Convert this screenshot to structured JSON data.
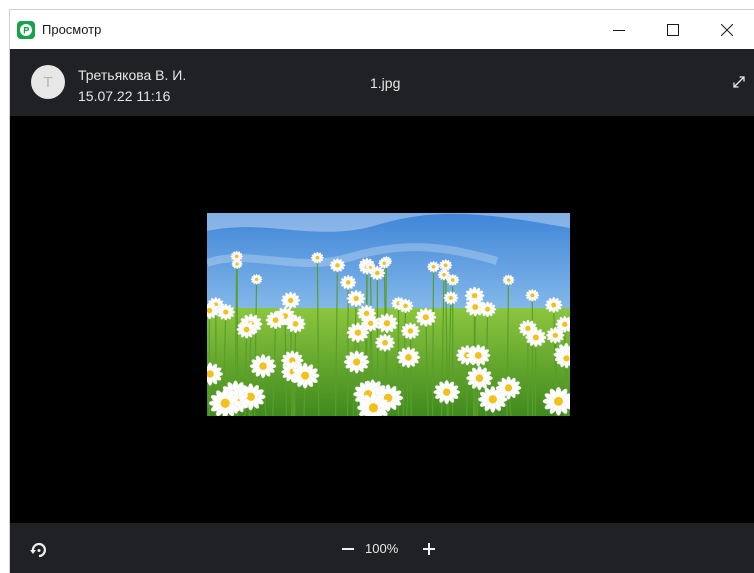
{
  "window": {
    "title": "Просмотр",
    "controls": [
      "minimize",
      "maximize",
      "close"
    ]
  },
  "header": {
    "avatar_initial": "Т",
    "author": "Третьякова В. И.",
    "date": "15.07.22 11:16",
    "filename": "1.jpg"
  },
  "footer": {
    "zoom_level": "100%"
  },
  "icons": {
    "app": "app-logo-icon",
    "expand": "expand-icon",
    "rotate": "rotate-icon",
    "zoom_out": "minus-icon",
    "zoom_in": "plus-icon"
  },
  "colors": {
    "toolbar_bg": "#202124",
    "viewer_bg": "#000000",
    "brand": "#16a34a"
  }
}
